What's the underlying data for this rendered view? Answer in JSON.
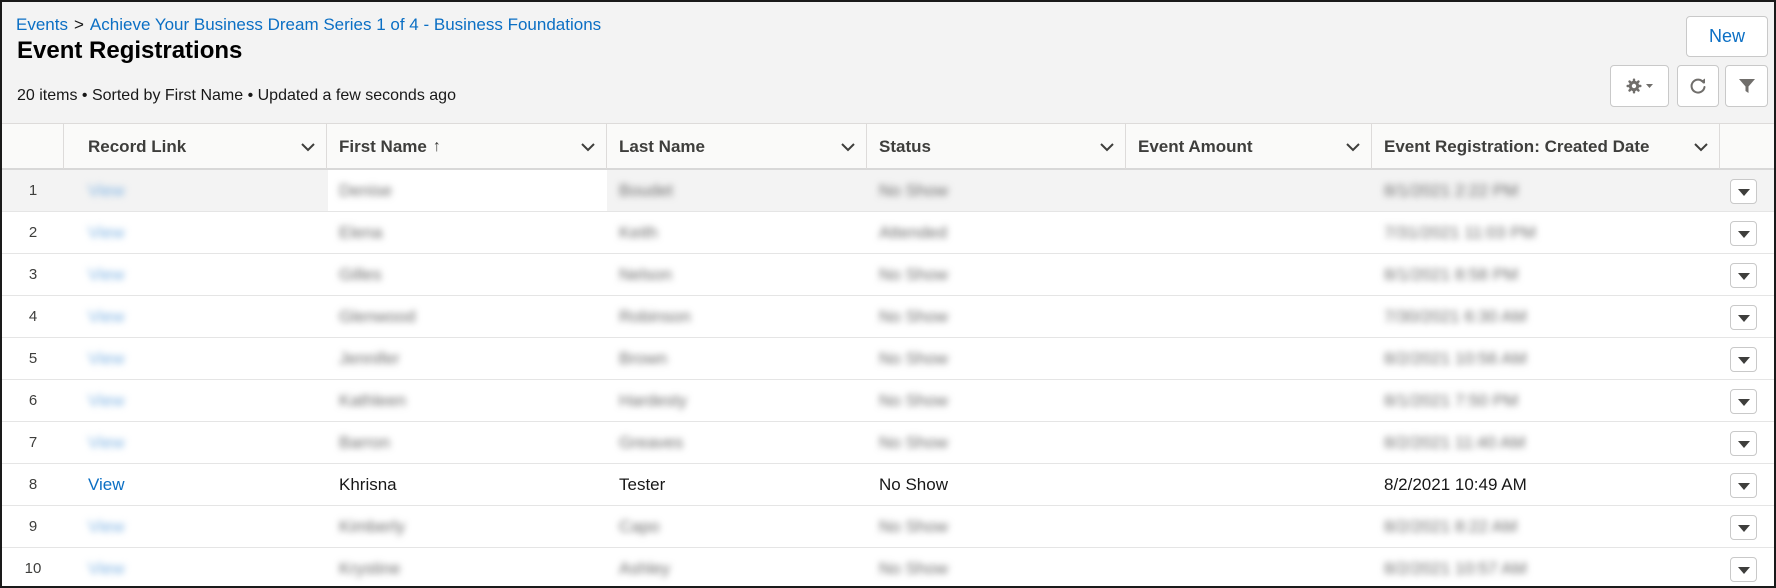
{
  "breadcrumb": {
    "root": "Events",
    "separator": ">",
    "current": "Achieve Your Business Dream Series 1 of 4 - Business Foundations"
  },
  "title": "Event Registrations",
  "meta": "20 items • Sorted by First Name • Updated a few seconds ago",
  "buttons": {
    "new": "New",
    "settings_icon": "gear-icon",
    "refresh_icon": "refresh-icon",
    "filter_icon": "filter-icon"
  },
  "columns": [
    {
      "label": "Record Link"
    },
    {
      "label": "First Name",
      "sorted": "ascending"
    },
    {
      "label": "Last Name"
    },
    {
      "label": "Status"
    },
    {
      "label": "Event Amount"
    },
    {
      "label": "Event Registration: Created Date"
    }
  ],
  "sort_arrow": "↑",
  "rows": [
    {
      "num": "1",
      "link": "View",
      "first": "Denise",
      "last": "Boudet",
      "status": "No Show",
      "amount": "",
      "created": "8/1/2021 2:22 PM",
      "blurred": true
    },
    {
      "num": "2",
      "link": "View",
      "first": "Elena",
      "last": "Keith",
      "status": "Attended",
      "amount": "",
      "created": "7/31/2021 11:03 PM",
      "blurred": true
    },
    {
      "num": "3",
      "link": "View",
      "first": "Gilles",
      "last": "Nelson",
      "status": "No Show",
      "amount": "",
      "created": "8/1/2021 8:58 PM",
      "blurred": true
    },
    {
      "num": "4",
      "link": "View",
      "first": "Glenwood",
      "last": "Robinson",
      "status": "No Show",
      "amount": "",
      "created": "7/30/2021 6:30 AM",
      "blurred": true
    },
    {
      "num": "5",
      "link": "View",
      "first": "Jennifer",
      "last": "Brown",
      "status": "No Show",
      "amount": "",
      "created": "8/2/2021 10:56 AM",
      "blurred": true
    },
    {
      "num": "6",
      "link": "View",
      "first": "Kathleen",
      "last": "Hardesty",
      "status": "No Show",
      "amount": "",
      "created": "8/1/2021 7:50 PM",
      "blurred": true
    },
    {
      "num": "7",
      "link": "View",
      "first": "Barron",
      "last": "Greaves",
      "status": "No Show",
      "amount": "",
      "created": "8/2/2021 11:40 AM",
      "blurred": true
    },
    {
      "num": "8",
      "link": "View",
      "first": "Khrisna",
      "last": "Tester",
      "status": "No Show",
      "amount": "",
      "created": "8/2/2021 10:49 AM",
      "blurred": false
    },
    {
      "num": "9",
      "link": "View",
      "first": "Kimberly",
      "last": "Capo",
      "status": "No Show",
      "amount": "",
      "created": "8/2/2021 8:22 AM",
      "blurred": true
    },
    {
      "num": "10",
      "link": "View",
      "first": "Krystine",
      "last": "Ashley",
      "status": "No Show",
      "amount": "",
      "created": "8/2/2021 10:57 AM",
      "blurred": true
    }
  ],
  "colors": {
    "link": "#0b6fc4",
    "header_bg": "#f3f3f3",
    "border": "#dddbda"
  }
}
